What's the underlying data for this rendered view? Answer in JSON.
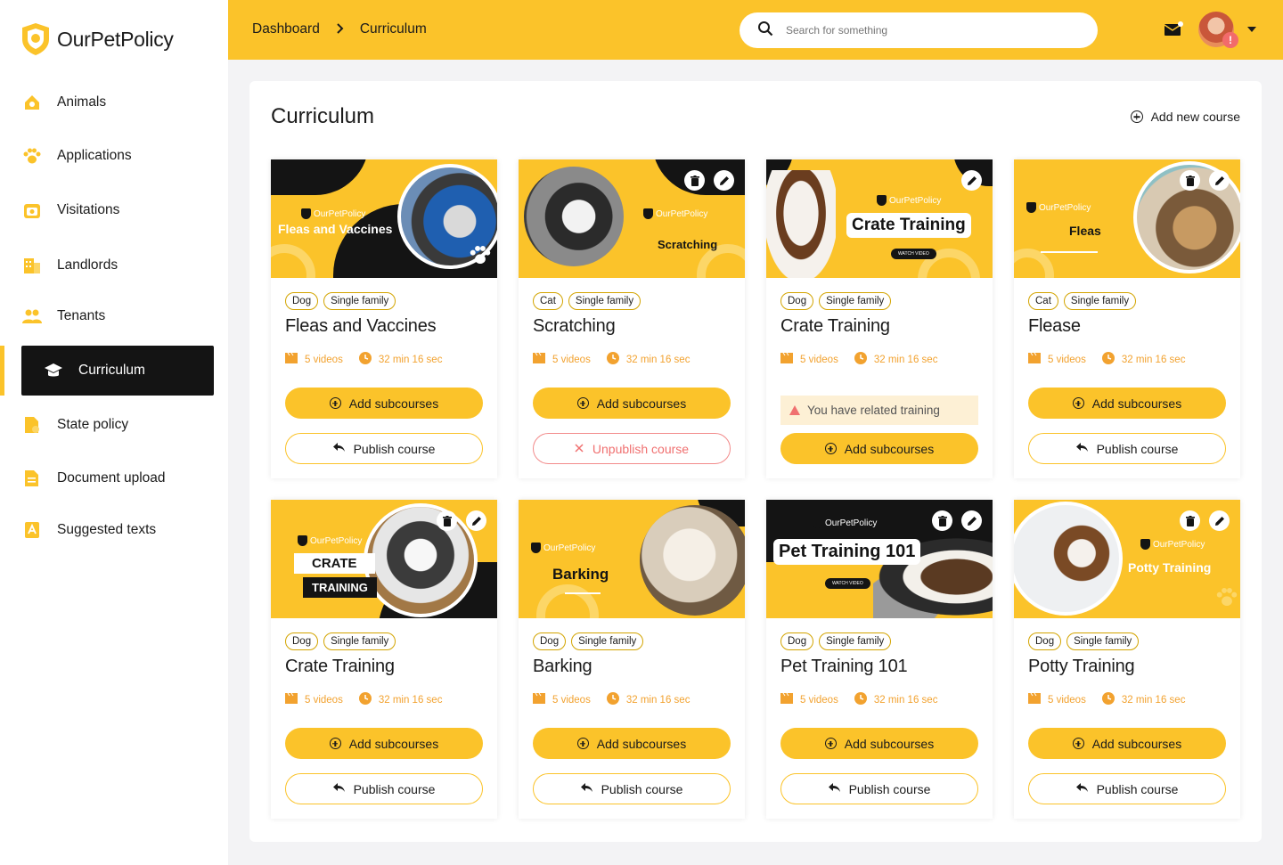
{
  "brand": {
    "name": "OurPetPolicy",
    "accent": "#fbc32a",
    "dark": "#141414"
  },
  "sidebar": {
    "items": [
      {
        "label": "Animals",
        "icon": "house-pet-icon"
      },
      {
        "label": "Applications",
        "icon": "paw-icon"
      },
      {
        "label": "Visitations",
        "icon": "calendar-pet-icon"
      },
      {
        "label": "Landlords",
        "icon": "building-icon"
      },
      {
        "label": "Tenants",
        "icon": "people-icon"
      },
      {
        "label": "Curriculum",
        "icon": "graduation-cap-icon",
        "active": true
      },
      {
        "label": "State policy",
        "icon": "document-policy-icon"
      },
      {
        "label": "Document upload",
        "icon": "document-icon"
      },
      {
        "label": "Suggested texts",
        "icon": "text-a-icon"
      }
    ]
  },
  "header": {
    "breadcrumb": [
      "Dashboard",
      "Curriculum"
    ],
    "search_placeholder": "Search for something",
    "avatar_badge": "!"
  },
  "main": {
    "title": "Curriculum",
    "add_course_label": "Add new course",
    "add_subcourses_label": "Add subcourses",
    "publish_label": "Publish course",
    "unpublish_label": "Unpublish course",
    "warning_text": "You have related training",
    "cards": [
      {
        "thumb_brand": "OurPetPolicy",
        "thumb_headline": "Fleas and Vaccines",
        "tags": [
          "Dog",
          "Single family"
        ],
        "title": "Fleas and Vaccines",
        "videos": "5 videos",
        "duration": "32 min 16 sec",
        "state": "publish",
        "edit": false
      },
      {
        "thumb_brand": "OurPetPolicy",
        "thumb_headline": "Scratching",
        "tags": [
          "Cat",
          "Single family"
        ],
        "title": "Scratching",
        "videos": "5 videos",
        "duration": "32 min 16 sec",
        "state": "unpublish",
        "edit": true
      },
      {
        "thumb_brand": "OurPetPolicy",
        "thumb_headline": "Crate Training",
        "thumb_sub": "WATCH VIDEO",
        "tags": [
          "Dog",
          "Single family"
        ],
        "title": "Crate Training",
        "videos": "5 videos",
        "duration": "32 min 16 sec",
        "state": "warning",
        "edit": "pencil-only"
      },
      {
        "thumb_brand": "OurPetPolicy",
        "thumb_headline": "Fleas",
        "tags": [
          "Cat",
          "Single family"
        ],
        "title": "Flease",
        "videos": "5 videos",
        "duration": "32 min 16 sec",
        "state": "publish",
        "edit": true
      },
      {
        "thumb_brand": "OurPetPolicy",
        "thumb_headline": "CRATE",
        "thumb_headline2": "TRAINING",
        "tags": [
          "Dog",
          "Single family"
        ],
        "title": "Crate Training",
        "videos": "5 videos",
        "duration": "32 min 16 sec",
        "state": "publish",
        "edit": true
      },
      {
        "thumb_brand": "OurPetPolicy",
        "thumb_headline": "Barking",
        "tags": [
          "Dog",
          "Single family"
        ],
        "title": "Barking",
        "videos": "5 videos",
        "duration": "32 min 16 sec",
        "state": "publish",
        "edit": false
      },
      {
        "thumb_brand": "OurPetPolicy",
        "thumb_headline": "Pet Training 101",
        "thumb_sub": "WATCH VIDEO",
        "tags": [
          "Dog",
          "Single family"
        ],
        "title": "Pet Training 101",
        "videos": "5 videos",
        "duration": "32 min 16 sec",
        "state": "publish",
        "edit": true
      },
      {
        "thumb_brand": "OurPetPolicy",
        "thumb_headline": "Potty Training",
        "tags": [
          "Dog",
          "Single family"
        ],
        "title": "Potty Training",
        "videos": "5 videos",
        "duration": "32 min 16 sec",
        "state": "publish",
        "edit": true
      }
    ]
  }
}
